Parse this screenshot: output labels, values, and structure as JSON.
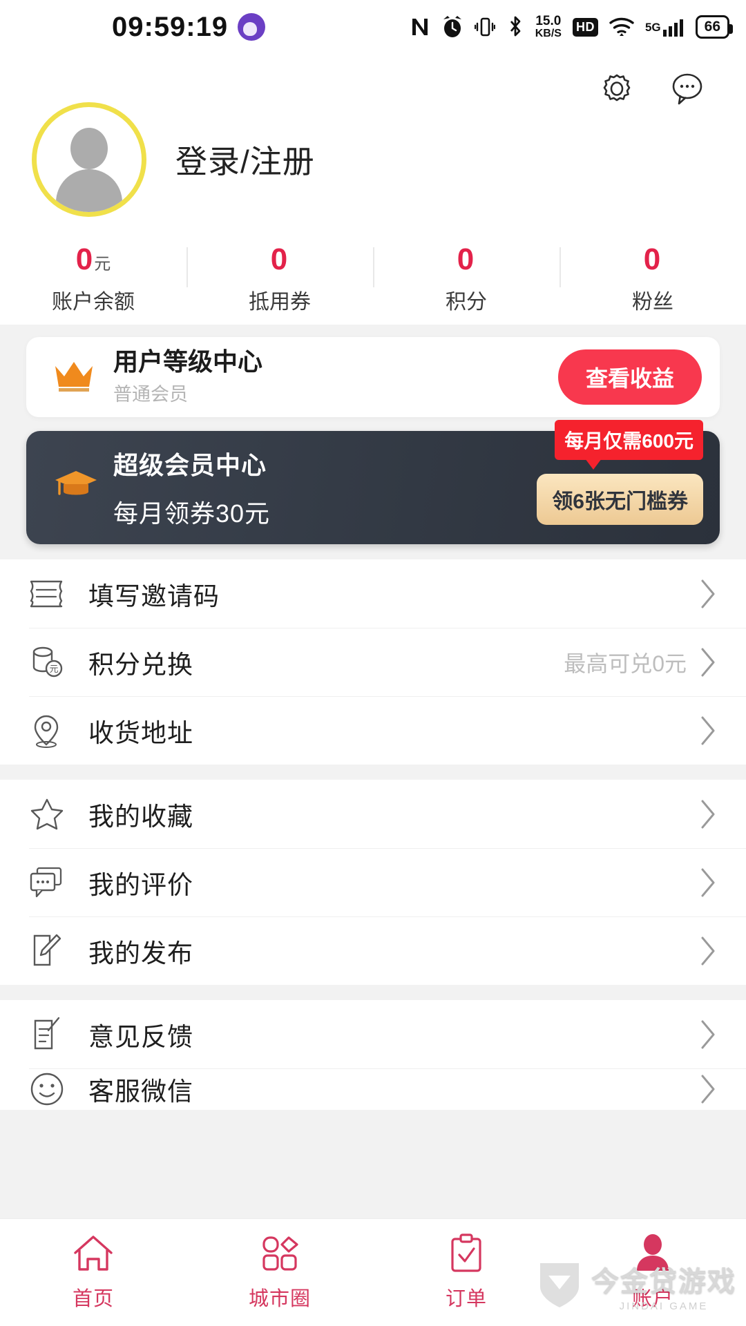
{
  "status_bar": {
    "time": "09:59:19",
    "avatar_icon": "anime-avatar-icon",
    "icons": [
      "nfc-icon",
      "alarm-clock-icon",
      "vibrate-icon",
      "bluetooth-icon"
    ],
    "net_speed_value": "15.0",
    "net_speed_unit": "KB/S",
    "hd_label": "HD",
    "wifi_icon": "wifi-icon",
    "network_type": "5G",
    "signal_icon": "signal-bars-icon",
    "battery_level": "66"
  },
  "header": {
    "settings_icon": "gear-icon",
    "message_icon": "chat-bubble-icon",
    "avatar_icon": "default-user-avatar",
    "login_label": "登录/注册"
  },
  "stats": [
    {
      "value": "0",
      "unit": "元",
      "label": "账户余额"
    },
    {
      "value": "0",
      "unit": "",
      "label": "抵用券"
    },
    {
      "value": "0",
      "unit": "",
      "label": "积分"
    },
    {
      "value": "0",
      "unit": "",
      "label": "粉丝"
    }
  ],
  "level_card": {
    "icon": "crown-icon",
    "title": "用户等级中心",
    "subtitle": "普通会员",
    "button_label": "查看收益"
  },
  "super_card": {
    "icon": "graduation-cap-icon",
    "title": "超级会员中心",
    "subtitle": "每月领券30元",
    "price_tag": "每月仅需600元",
    "button_label": "领6张无门槛券"
  },
  "menu_groups": [
    {
      "items": [
        {
          "icon": "ticket-icon",
          "label": "填写邀请码",
          "value": ""
        },
        {
          "icon": "coin-stack-icon",
          "label": "积分兑换",
          "value": "最高可兑0元"
        },
        {
          "icon": "location-pin-icon",
          "label": "收货地址",
          "value": ""
        }
      ]
    },
    {
      "items": [
        {
          "icon": "star-icon",
          "label": "我的收藏",
          "value": ""
        },
        {
          "icon": "comment-icon",
          "label": "我的评价",
          "value": ""
        },
        {
          "icon": "edit-note-icon",
          "label": "我的发布",
          "value": ""
        }
      ]
    },
    {
      "items": [
        {
          "icon": "feedback-doc-icon",
          "label": "意见反馈",
          "value": ""
        },
        {
          "icon": "smiley-face-icon",
          "label": "客服微信",
          "value": ""
        }
      ]
    }
  ],
  "tabbar": [
    {
      "icon": "home-icon",
      "label": "首页",
      "active": false
    },
    {
      "icon": "city-grid-icon",
      "label": "城市圈",
      "active": false
    },
    {
      "icon": "clipboard-check-icon",
      "label": "订单",
      "active": false
    },
    {
      "icon": "person-icon",
      "label": "账户",
      "active": true
    }
  ],
  "watermark": {
    "main": "今金贷游戏",
    "sub": "JINDAI GAME"
  },
  "colors": {
    "accent_red": "#e3224a",
    "button_red": "#f8384e",
    "tag_red": "#f5222d",
    "gold": "#edc993",
    "ring_yellow": "#f0e04a",
    "tab_active": "#d5375f"
  }
}
